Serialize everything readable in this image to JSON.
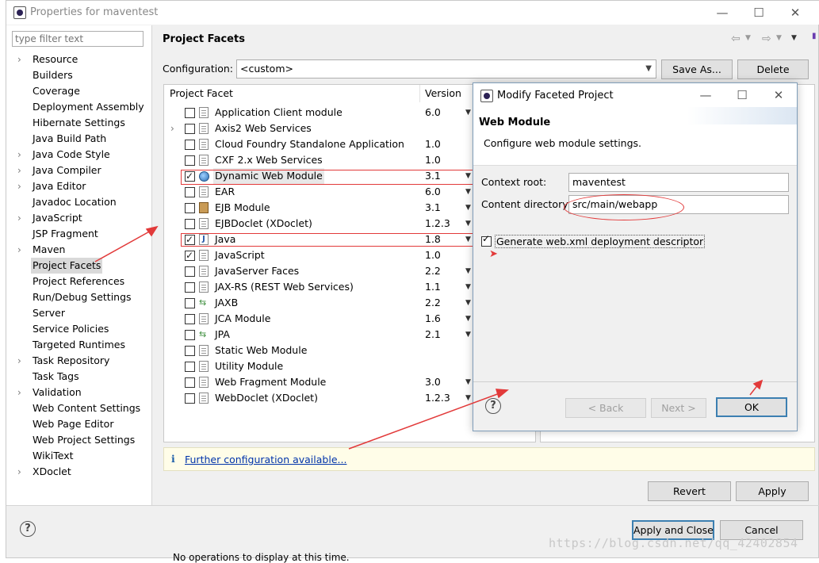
{
  "window": {
    "title": "Properties for maventest"
  },
  "filter": {
    "placeholder": "type filter text"
  },
  "tree": [
    {
      "label": "Resource",
      "expandable": true
    },
    {
      "label": "Builders",
      "expandable": false
    },
    {
      "label": "Coverage",
      "expandable": false
    },
    {
      "label": "Deployment Assembly",
      "expandable": false
    },
    {
      "label": "Hibernate Settings",
      "expandable": false
    },
    {
      "label": "Java Build Path",
      "expandable": false
    },
    {
      "label": "Java Code Style",
      "expandable": true
    },
    {
      "label": "Java Compiler",
      "expandable": true
    },
    {
      "label": "Java Editor",
      "expandable": true
    },
    {
      "label": "Javadoc Location",
      "expandable": false
    },
    {
      "label": "JavaScript",
      "expandable": true
    },
    {
      "label": "JSP Fragment",
      "expandable": false
    },
    {
      "label": "Maven",
      "expandable": true
    },
    {
      "label": "Project Facets",
      "expandable": false,
      "selected": true
    },
    {
      "label": "Project References",
      "expandable": false
    },
    {
      "label": "Run/Debug Settings",
      "expandable": false
    },
    {
      "label": "Server",
      "expandable": false
    },
    {
      "label": "Service Policies",
      "expandable": false
    },
    {
      "label": "Targeted Runtimes",
      "expandable": false
    },
    {
      "label": "Task Repository",
      "expandable": true
    },
    {
      "label": "Task Tags",
      "expandable": false
    },
    {
      "label": "Validation",
      "expandable": true
    },
    {
      "label": "Web Content Settings",
      "expandable": false
    },
    {
      "label": "Web Page Editor",
      "expandable": false
    },
    {
      "label": "Web Project Settings",
      "expandable": false
    },
    {
      "label": "WikiText",
      "expandable": false
    },
    {
      "label": "XDoclet",
      "expandable": true
    }
  ],
  "page": {
    "title": "Project Facets"
  },
  "config": {
    "label": "Configuration:",
    "value": "<custom>",
    "save_as": "Save As...",
    "delete": "Delete"
  },
  "facets": {
    "col_facet": "Project Facet",
    "col_version": "Version",
    "rows": [
      {
        "name": "Application Client module",
        "version": "6.0",
        "checked": false,
        "icon": "doc",
        "dropdown": true
      },
      {
        "name": "Axis2 Web Services",
        "version": "",
        "checked": false,
        "icon": "doc",
        "expandable": true
      },
      {
        "name": "Cloud Foundry Standalone Application",
        "version": "1.0",
        "checked": false,
        "icon": "doc"
      },
      {
        "name": "CXF 2.x Web Services",
        "version": "1.0",
        "checked": false,
        "icon": "doc"
      },
      {
        "name": "Dynamic Web Module",
        "version": "3.1",
        "checked": true,
        "icon": "globe",
        "dropdown": true,
        "highlight": true
      },
      {
        "name": "EAR",
        "version": "6.0",
        "checked": false,
        "icon": "doc",
        "dropdown": true
      },
      {
        "name": "EJB Module",
        "version": "3.1",
        "checked": false,
        "icon": "jar",
        "dropdown": true
      },
      {
        "name": "EJBDoclet (XDoclet)",
        "version": "1.2.3",
        "checked": false,
        "icon": "doc",
        "dropdown": true
      },
      {
        "name": "Java",
        "version": "1.8",
        "checked": true,
        "icon": "java",
        "dropdown": true
      },
      {
        "name": "JavaScript",
        "version": "1.0",
        "checked": true,
        "icon": "doc"
      },
      {
        "name": "JavaServer Faces",
        "version": "2.2",
        "checked": false,
        "icon": "doc",
        "dropdown": true
      },
      {
        "name": "JAX-RS (REST Web Services)",
        "version": "1.1",
        "checked": false,
        "icon": "doc",
        "dropdown": true
      },
      {
        "name": "JAXB",
        "version": "2.2",
        "checked": false,
        "icon": "arrows",
        "dropdown": true
      },
      {
        "name": "JCA Module",
        "version": "1.6",
        "checked": false,
        "icon": "doc",
        "dropdown": true
      },
      {
        "name": "JPA",
        "version": "2.1",
        "checked": false,
        "icon": "arrows",
        "dropdown": true
      },
      {
        "name": "Static Web Module",
        "version": "",
        "checked": false,
        "icon": "doc"
      },
      {
        "name": "Utility Module",
        "version": "",
        "checked": false,
        "icon": "doc"
      },
      {
        "name": "Web Fragment Module",
        "version": "3.0",
        "checked": false,
        "icon": "doc",
        "dropdown": true
      },
      {
        "name": "WebDoclet (XDoclet)",
        "version": "1.2.3",
        "checked": false,
        "icon": "doc",
        "dropdown": true
      }
    ]
  },
  "info": {
    "link": "Further configuration available..."
  },
  "buttons": {
    "revert": "Revert",
    "apply": "Apply",
    "apply_close": "Apply and Close",
    "cancel": "Cancel"
  },
  "dialog": {
    "title": "Modify Faceted Project",
    "heading": "Web Module",
    "description": "Configure web module settings.",
    "context_root_label": "Context root:",
    "context_root_value": "maventest",
    "content_dir_label": "Content directory:",
    "content_dir_value": "src/main/webapp",
    "generate_xml_label": "Generate web.xml deployment descriptor",
    "generate_xml_checked": true,
    "back": "< Back",
    "next": "Next >",
    "ok": "OK"
  },
  "bottom_status": {
    "text": "No operations to display at this time."
  },
  "watermark": {
    "text": "https://blog.csdn.net/qq_42402854"
  },
  "colors": {
    "annotation_red": "#e23a3a",
    "link_blue": "#0033aa",
    "default_button_border": "#3c7fb1"
  }
}
